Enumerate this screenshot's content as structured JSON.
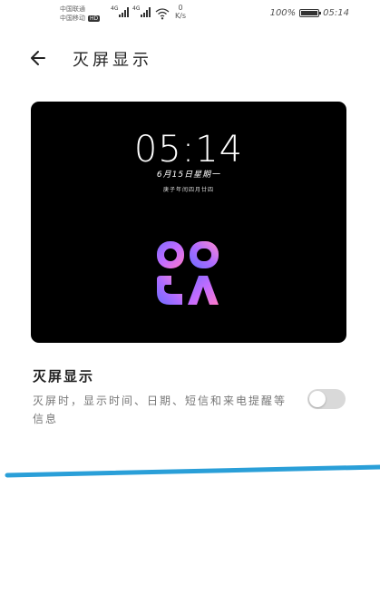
{
  "status_bar": {
    "carrier1": "中国联通",
    "carrier2": "中国移动",
    "hd_badge": "HD",
    "sim1_label": "4G",
    "sim2_label": "4G",
    "net_speed_value": "0",
    "net_speed_unit": "K/s",
    "battery": "100%",
    "time": "05:14"
  },
  "header": {
    "title": "灭屏显示",
    "back_icon": "arrow-left-icon"
  },
  "preview": {
    "clock": "05:14",
    "date": "6月15日星期一",
    "lunar": "庚子年闰四月廿四",
    "art_icon": "abstract-clock-art"
  },
  "setting": {
    "title": "灭屏显示",
    "description": "灭屏时，显示时间、日期、短信和来电提醒等信息",
    "enabled": false
  },
  "colors": {
    "accent_line": "#2a9fd8",
    "toggle_off": "#d9d9d9",
    "preview_bg": "#000000"
  }
}
